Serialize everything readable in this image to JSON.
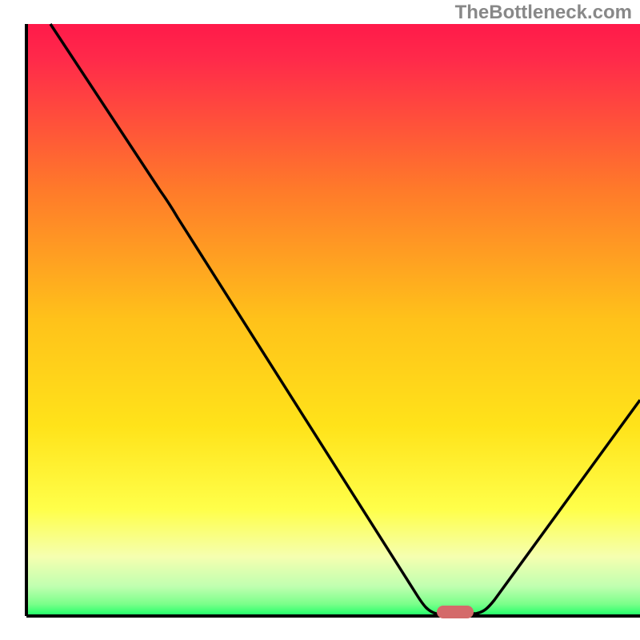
{
  "watermark": "TheBottleneck.com",
  "chart_data": {
    "type": "line",
    "title": "",
    "xlabel": "",
    "ylabel": "",
    "xlim": [
      0,
      100
    ],
    "ylim": [
      0,
      100
    ],
    "gradient_colors": {
      "top": "#ff1a4a",
      "mid_upper": "#ff8c1a",
      "mid": "#ffe31a",
      "mid_lower": "#ffff66",
      "lower": "#e6ffcc",
      "bottom": "#1aff66"
    },
    "curve_points": [
      {
        "x": 4,
        "y": 100
      },
      {
        "x": 22,
        "y": 72
      },
      {
        "x": 65,
        "y": 3
      },
      {
        "x": 67,
        "y": 0
      },
      {
        "x": 74,
        "y": 0
      },
      {
        "x": 76,
        "y": 2
      },
      {
        "x": 100,
        "y": 36
      }
    ],
    "marker": {
      "x": 70,
      "y": 0.5,
      "color": "#d46a6a",
      "width": 6,
      "height": 2
    },
    "axes": {
      "color": "#000000",
      "width": 3
    },
    "description": "Bottleneck curve showing optimal point around x=70 where the black curve reaches minimum (marked with red indicator), rising on both sides against a rainbow heat-map gradient background from red (top/high bottleneck) to green (bottom/low bottleneck)."
  }
}
